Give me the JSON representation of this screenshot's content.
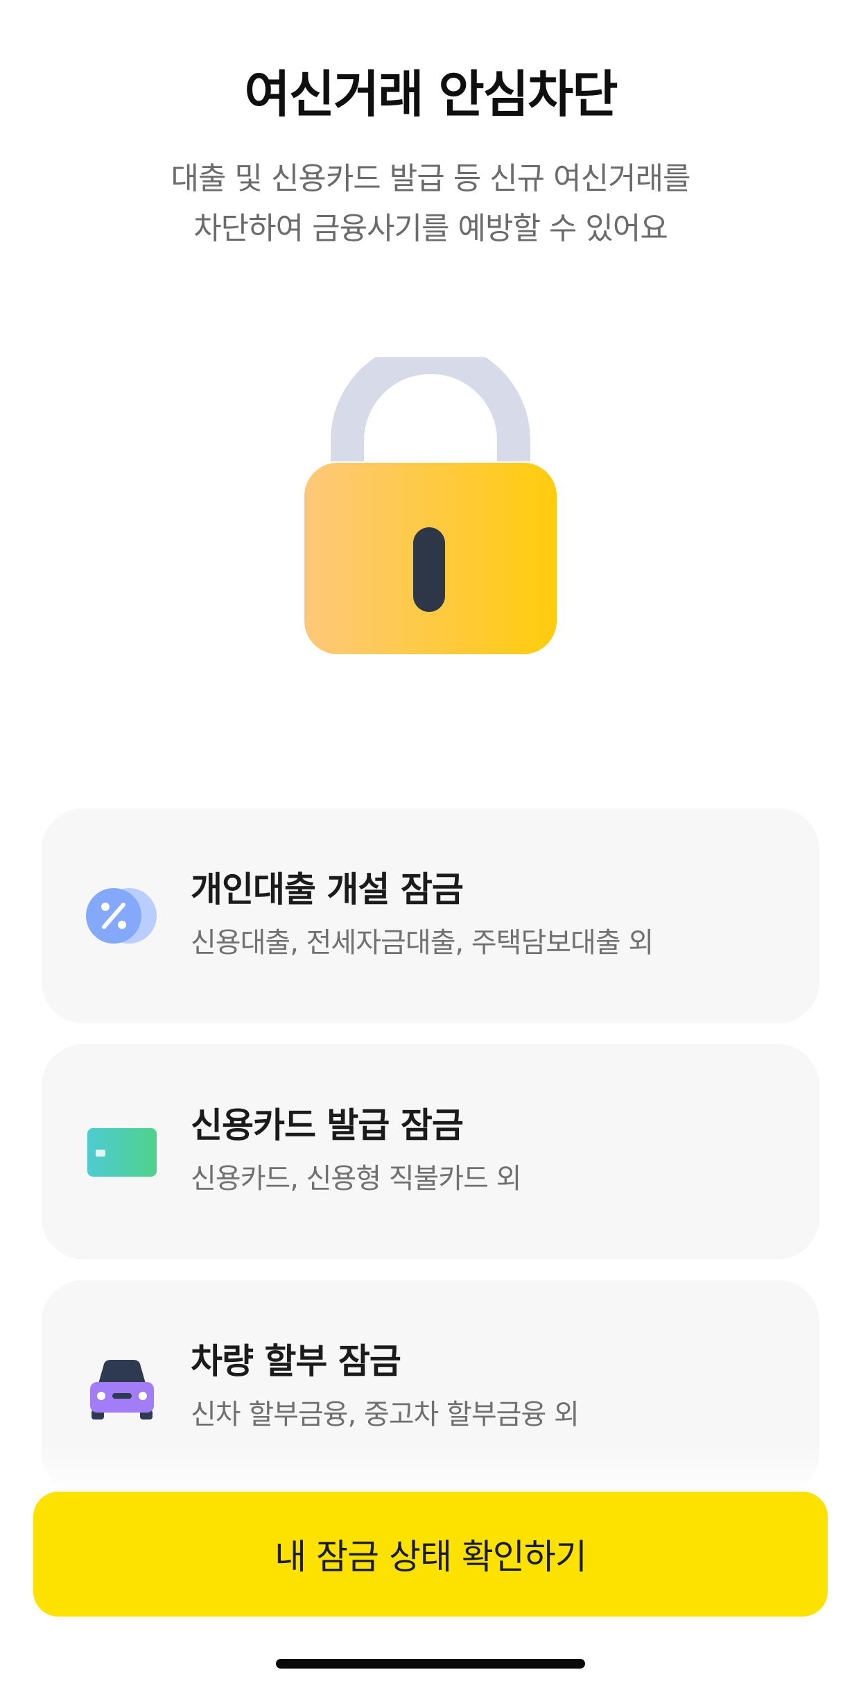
{
  "header": {
    "title": "여신거래 안심차단",
    "subtitle_line1": "대출 및 신용카드 발급 등 신규 여신거래를",
    "subtitle_line2": "차단하여 금융사기를 예방할 수 있어요"
  },
  "hero": {
    "icon": "padlock-icon",
    "colors": {
      "shackle": "#d7dbe9",
      "body_left": "#fec87a",
      "body_right": "#ffcc0d",
      "keyhole": "#2d3748"
    }
  },
  "lock_items": [
    {
      "title": "개인대출 개설 잠금",
      "description": "신용대출, 전세자금대출, 주택담보대출 외",
      "icon": "percent-coin-icon"
    },
    {
      "title": "신용카드 발급 잠금",
      "description": "신용카드, 신용형 직불카드 외",
      "icon": "credit-card-icon"
    },
    {
      "title": "차량 할부 잠금",
      "description": "신차 할부금융, 중고차 할부금융 외",
      "icon": "car-icon"
    }
  ],
  "cta": {
    "label": "내 잠금 상태 확인하기",
    "color": "#fde200"
  }
}
